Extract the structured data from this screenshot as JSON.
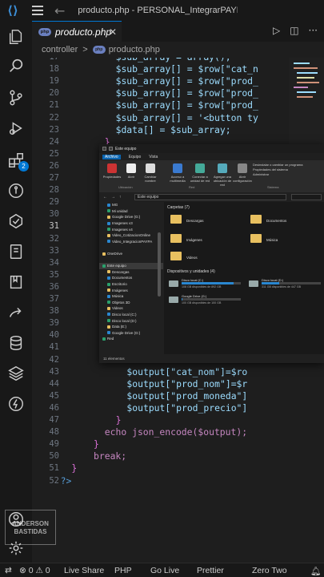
{
  "titlebar": {
    "title": "producto.php - PERSONAL_IntegrarPAYP..."
  },
  "tab": {
    "label": "producto.php",
    "php_badge": "php"
  },
  "breadcrumb": {
    "folder": "controller",
    "file": "producto.php",
    "sep": ">"
  },
  "activity": {
    "source_control_badge": "2"
  },
  "code": {
    "active_line": 31,
    "lines": [
      {
        "n": 17,
        "t": "$sub_array = array();"
      },
      {
        "n": 18,
        "t": "$sub_array[] = $row[\"cat_n"
      },
      {
        "n": 19,
        "t": "$sub_array[] = $row[\"prod_"
      },
      {
        "n": 20,
        "t": "$sub_array[] = $row[\"prod_"
      },
      {
        "n": 21,
        "t": "$sub_array[] = $row[\"prod_"
      },
      {
        "n": 22,
        "t": "$sub_array[] = '<button ty"
      },
      {
        "n": 23,
        "t": "$data[] = $sub_array;"
      },
      {
        "n": 24,
        "t": "}"
      },
      {
        "n": 25,
        "t": ""
      },
      {
        "n": 26,
        "t": ""
      },
      {
        "n": 27,
        "t": ""
      },
      {
        "n": 28,
        "t": ""
      },
      {
        "n": 29,
        "t": ""
      },
      {
        "n": 30,
        "t": ""
      },
      {
        "n": 31,
        "t": ""
      },
      {
        "n": 32,
        "t": ""
      },
      {
        "n": 33,
        "t": ""
      },
      {
        "n": 34,
        "t": ""
      },
      {
        "n": 35,
        "t": ""
      },
      {
        "n": 36,
        "t": ""
      },
      {
        "n": 37,
        "t": ""
      },
      {
        "n": 38,
        "t": ""
      },
      {
        "n": 39,
        "t": ""
      },
      {
        "n": 40,
        "t": ""
      },
      {
        "n": 41,
        "t": ""
      },
      {
        "n": 42,
        "t": ""
      },
      {
        "n": 43,
        "t": "$output[\"cat_nom\"]=$ro"
      },
      {
        "n": 44,
        "t": "$output[\"prod_nom\"]=$r"
      },
      {
        "n": 45,
        "t": "$output[\"prod_moneda\"]"
      },
      {
        "n": 46,
        "t": "$output[\"prod_precio\"]"
      },
      {
        "n": 47,
        "t": "}"
      },
      {
        "n": 48,
        "t": "echo json_encode($output);"
      },
      {
        "n": 49,
        "t": "}"
      },
      {
        "n": 50,
        "t": "break;"
      },
      {
        "n": 51,
        "t": "}"
      },
      {
        "n": 52,
        "t": "?>"
      }
    ]
  },
  "explorer": {
    "title": "Este equipo",
    "menu": [
      "Archivo",
      "Equipo",
      "Vista"
    ],
    "ribbon": {
      "buttons": [
        "Propiedades",
        "Abrir",
        "Cambiar nombre",
        "Acceso a multimedia",
        "Conectar a unidad de red",
        "Agregar una ubicación de red",
        "Abrir configuración"
      ],
      "side": [
        "Desinstalar o cambiar un programa",
        "Propiedades del sistema",
        "Administrar"
      ],
      "groups": [
        "Ubicación",
        "Red",
        "Sistema"
      ]
    },
    "address": "Este equipo",
    "nav": [
      "MG",
      "Mi unidad",
      "Google Drive (G:)",
      "Imagenes v3",
      "Imagenes v4",
      "Video_CotizacionOnline",
      "Video_IntegracionPAYPA",
      "",
      "OneDrive",
      "",
      "Este equipo",
      "Descargas",
      "Documentos",
      "Escritorio",
      "Imágenes",
      "Música",
      "Objetos 3D",
      "Videos",
      "Disco local (C:)",
      "Disco local (D:)",
      "Data (E:)",
      "Google Drive (G:)",
      "Red"
    ],
    "folders_header": "Carpetas (7)",
    "folders": [
      "Descargas",
      "Documentos",
      "Imágenes",
      "Música",
      "Videos"
    ],
    "drives_header": "Dispositivos y unidades (4)",
    "drives": [
      {
        "name": "Disco local (C:)",
        "detail": "108 GB disponibles de 892 GB",
        "used": 0.88
      },
      {
        "name": "Disco local (D:)",
        "detail": "311 GB disponibles de 447 GB",
        "used": 0.3
      },
      {
        "name": "Google Drive (G:)",
        "detail": "100 GB disponibles de 100 GB",
        "used": 0.02
      }
    ],
    "status": "11 elementos"
  },
  "watermark": {
    "line1": "ANDERSON",
    "line2": "BASTIDAS"
  },
  "statusbar": {
    "problems": "⊗ 0 ⚠ 0",
    "live_share": "Live Share",
    "language": "PHP",
    "go_live": "Go Live",
    "prettier": "Prettier",
    "theme": "Zero Two"
  }
}
